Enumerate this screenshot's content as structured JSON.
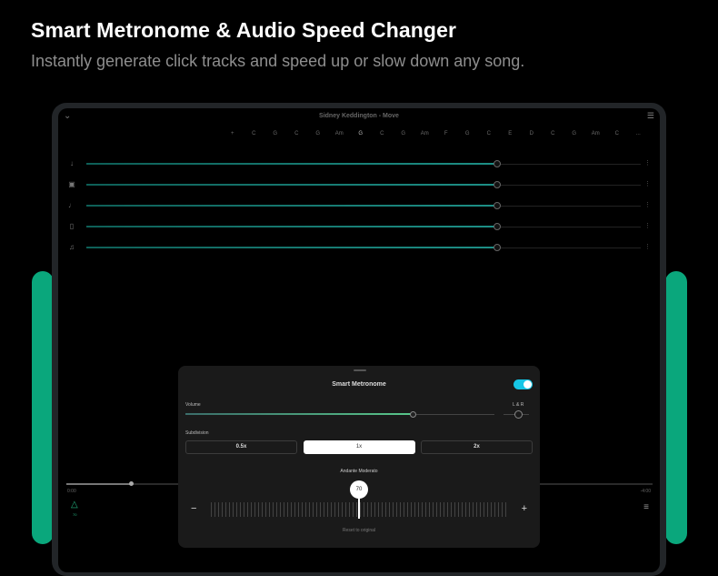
{
  "promo": {
    "headline": "Smart Metronome & Audio Speed Changer",
    "subline": "Instantly generate click tracks and speed up or slow down any song.",
    "accent_color": "#0aa77c"
  },
  "app": {
    "song_title": "Sidney Keddington - Move",
    "back_icon": "chevron-down-icon",
    "menu_icon": "hamburger-menu-icon",
    "chords": [
      "+",
      "C",
      "G",
      "C",
      "G",
      "Am",
      "G",
      "C",
      "G",
      "Am",
      "F",
      "G",
      "C",
      "E",
      "D",
      "C",
      "G",
      "Am",
      "C",
      "..."
    ],
    "tracks": [
      {
        "name": "vocals",
        "icon": "microphone-icon",
        "level": 0.74
      },
      {
        "name": "drums",
        "icon": "drum-icon",
        "level": 0.74
      },
      {
        "name": "bass",
        "icon": "bass-guitar-icon",
        "level": 0.74
      },
      {
        "name": "guitar",
        "icon": "guitar-icon",
        "level": 0.74
      },
      {
        "name": "other",
        "icon": "music-note-icon",
        "level": 0.74
      }
    ],
    "timeline": {
      "start": "0:00",
      "end": "-4:00",
      "progress": 0.11
    },
    "metronome_button_label": "70",
    "mixer_icon": "sliders-icon",
    "track_fill_color": "#1d8f86"
  },
  "metronome": {
    "title": "Smart Metronome",
    "enabled": true,
    "toggle_color": "#16c6e6",
    "volume_label": "Volume",
    "volume_level": 0.74,
    "volume_fill_color": "#58c68a",
    "pan_label": "L & R",
    "subdivision_label": "Subdivision",
    "subdivisions": [
      "0.5x",
      "1x",
      "2x"
    ],
    "selected_subdivision": "1x",
    "tempo_name": "Andante Moderato",
    "bpm": "70",
    "minus": "−",
    "plus": "+",
    "reset_label": "Reset to original"
  }
}
